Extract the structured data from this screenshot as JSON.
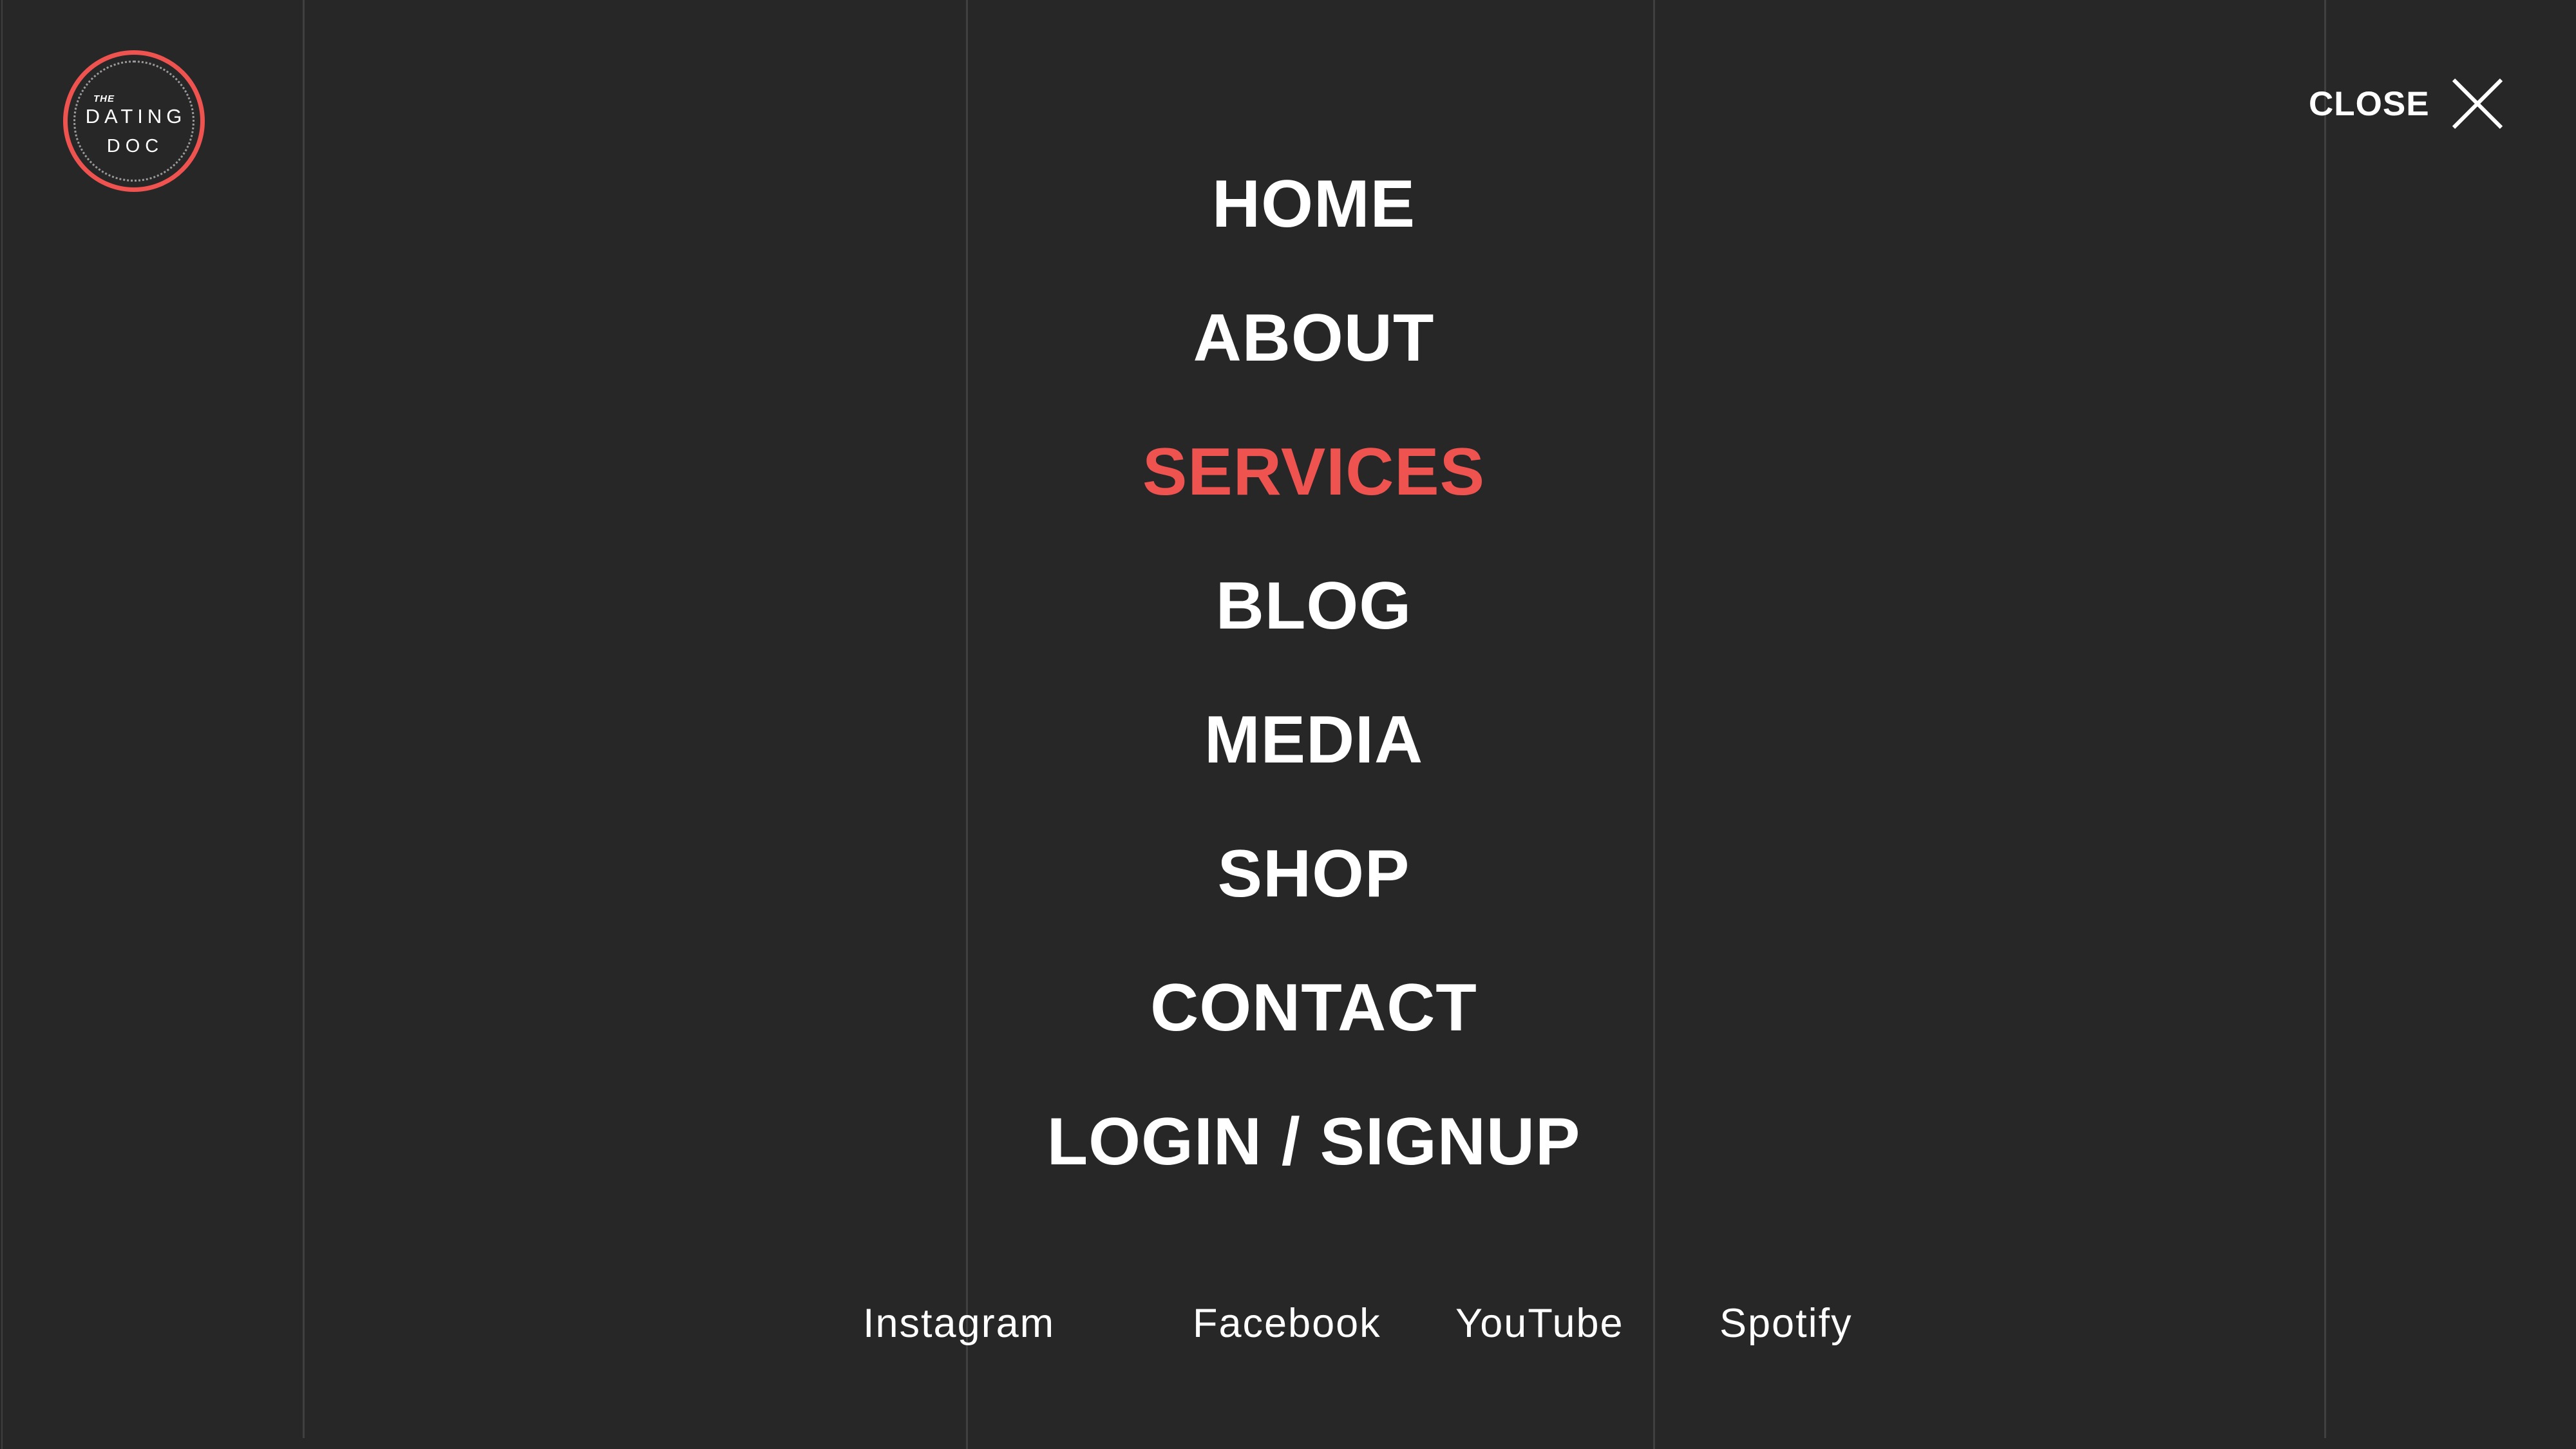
{
  "logo": {
    "line1": "THE",
    "line2": "DATING",
    "line3": "DOC"
  },
  "close": {
    "label": "CLOSE",
    "icon": "close-icon"
  },
  "menu": {
    "items": [
      {
        "label": "HOME",
        "active": false
      },
      {
        "label": "ABOUT",
        "active": false
      },
      {
        "label": "SERVICES",
        "active": true
      },
      {
        "label": "BLOG",
        "active": false
      },
      {
        "label": "MEDIA",
        "active": false
      },
      {
        "label": "SHOP",
        "active": false
      },
      {
        "label": "CONTACT",
        "active": false
      },
      {
        "label": "LOGIN / SIGNUP",
        "active": false
      }
    ]
  },
  "social": {
    "links": [
      "Instagram",
      "Facebook",
      "YouTube",
      "Spotify"
    ]
  },
  "colors": {
    "background": "#272727",
    "accent": "#ef5350",
    "text": "#ffffff"
  }
}
